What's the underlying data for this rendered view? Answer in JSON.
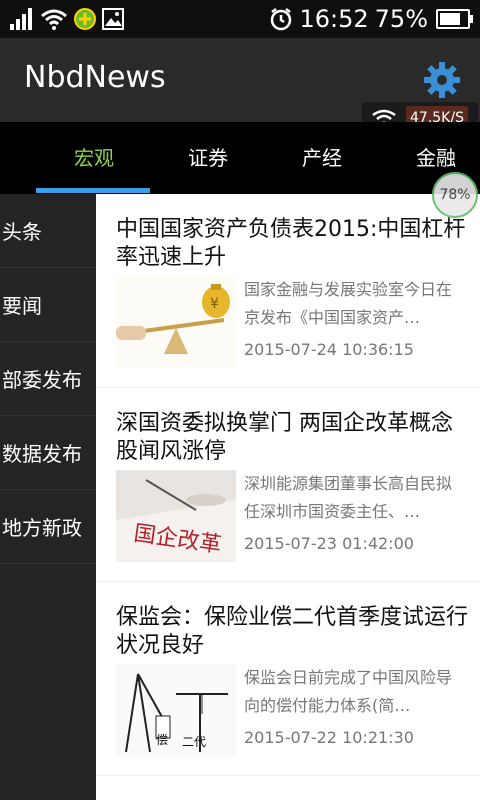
{
  "status_bar": {
    "time": "16:52",
    "battery_percent": "75%",
    "battery_level": 0.75
  },
  "app_bar": {
    "title": "NbdNews",
    "network_speed": "47.5K/S"
  },
  "tabs": [
    {
      "label": "宏观",
      "active": true
    },
    {
      "label": "证券",
      "active": false
    },
    {
      "label": "产经",
      "active": false
    },
    {
      "label": "金融",
      "active": false
    }
  ],
  "progress_badge": "78%",
  "sidebar": {
    "items": [
      {
        "label": "头条"
      },
      {
        "label": "要闻"
      },
      {
        "label": "部委发布"
      },
      {
        "label": "数据发布"
      },
      {
        "label": "地方新政"
      }
    ]
  },
  "articles": [
    {
      "title": "中国国家资产负债表2015:中国杠杆率迅速上升",
      "summary": "国家金融与发展实验室今日在京发布《中国国家资产…",
      "date": "2015-07-24 10:36:15"
    },
    {
      "title": "深国资委拟换掌门 两国企改革概念股闻风涨停",
      "summary": "深圳能源集团董事长高自民拟任深圳市国资委主任、…",
      "date": "2015-07-23 01:42:00",
      "image_text": "国企改革"
    },
    {
      "title": "保监会：保险业偿二代首季度试运行状况良好",
      "summary": "保监会日前完成了中国风险导向的偿付能力体系(简…",
      "date": "2015-07-22 10:21:30",
      "image_text_left": "偿",
      "image_text_right": "二代"
    }
  ],
  "colors": {
    "tab_active": "#8fd14f",
    "tab_indicator": "#3aa0e6",
    "gear": "#3b8fd6"
  }
}
